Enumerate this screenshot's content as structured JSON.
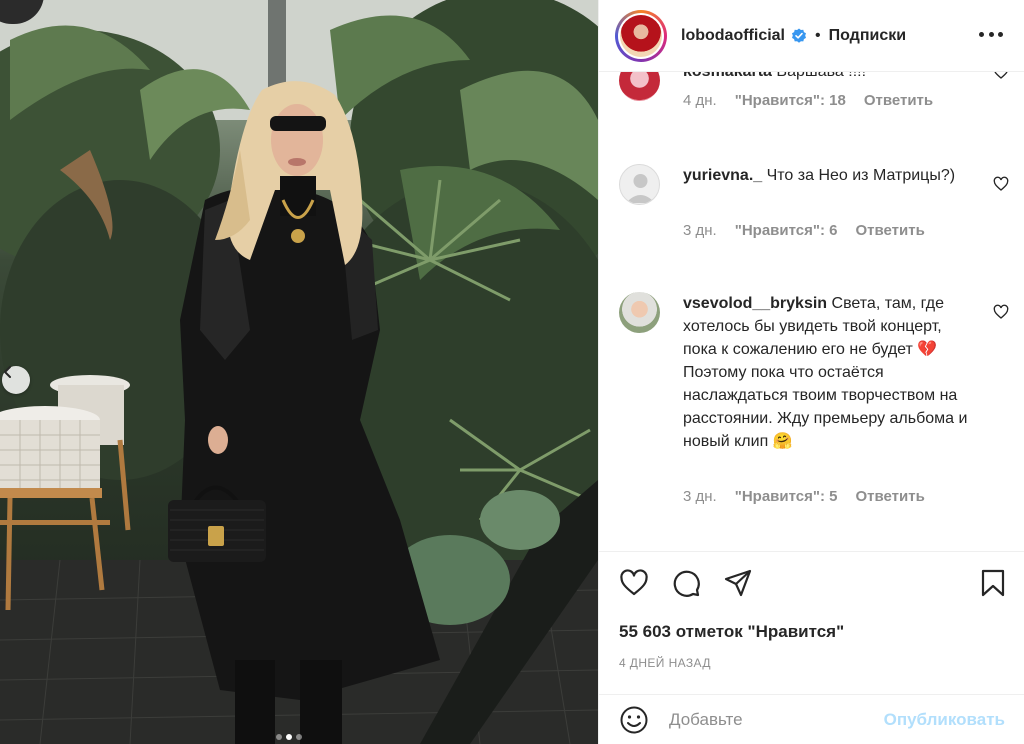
{
  "post": {
    "username": "lobodaofficial",
    "separator": "•",
    "follow_label": "Подписки",
    "verified": true
  },
  "comments": [
    {
      "user": "kosmakarta",
      "text": "Варшава !!!!",
      "time": "4 дн.",
      "likes": "\"Нравится\": 18",
      "reply": "Ответить"
    },
    {
      "user": "yurievna._",
      "text": "Что за Нео из Матрицы?)",
      "time": "3 дн.",
      "likes": "\"Нравится\": 6",
      "reply": "Ответить"
    },
    {
      "user": "vsevolod__bryksin",
      "text": "Света, там, где хотелось бы увидеть твой концерт, пока к сожалению его не будет 💔 Поэтому пока что остаётся наслаждаться твоим творчеством на расстоянии. Жду премьеру альбома и новый клип 🤗",
      "time": "3 дн.",
      "likes": "\"Нравится\": 5",
      "reply": "Ответить"
    }
  ],
  "likes_total": "55 603 отметок \"Нравится\"",
  "time_ago": "4 ДНЕЙ НАЗАД",
  "add_comment": {
    "placeholder": "Добавьте",
    "publish_label": "Опубликовать"
  },
  "carousel": {
    "slide_count": 3,
    "active_slide": 1
  },
  "colors": {
    "publish_disabled": "#b2dffc",
    "verified_badge": "#3897f0",
    "meta_text": "#8e8e8e",
    "broken_heart": "#d6204c"
  }
}
